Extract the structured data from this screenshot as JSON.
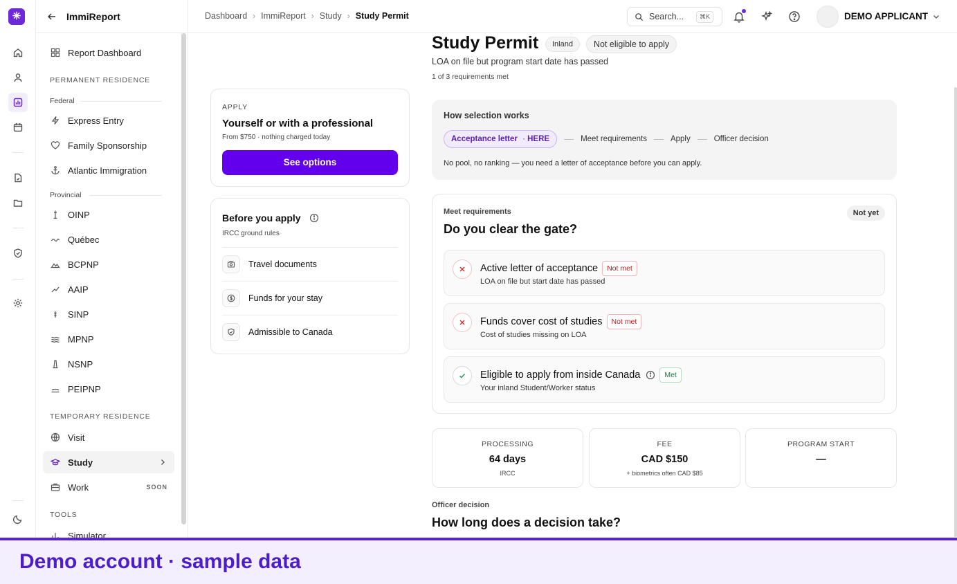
{
  "app": {
    "name": "ImmiReport"
  },
  "breadcrumbs": [
    "Dashboard",
    "ImmiReport",
    "Study",
    "Study Permit"
  ],
  "topbar": {
    "search_placeholder": "Search...",
    "search_shortcut": "⌘K",
    "user_name": "DEMO APPLICANT"
  },
  "sidebar": {
    "report_dashboard": "Report Dashboard",
    "section_pr": "PERMANENT RESIDENCE",
    "sub_federal": "Federal",
    "federal": [
      "Express Entry",
      "Family Sponsorship",
      "Atlantic Immigration"
    ],
    "sub_provincial": "Provincial",
    "provincial": [
      "OINP",
      "Québec",
      "BCPNP",
      "AAIP",
      "SINP",
      "MPNP",
      "NSNP",
      "PEIPNP"
    ],
    "section_tr": "TEMPORARY RESIDENCE",
    "temporary": [
      "Visit",
      "Study",
      "Work"
    ],
    "work_badge": "SOON",
    "section_tools": "TOOLS",
    "tools": [
      "Simulator"
    ]
  },
  "apply_card": {
    "eyebrow": "APPLY",
    "title": "Yourself or with a professional",
    "subtitle": "From $750 · nothing charged today",
    "button": "See options"
  },
  "before_card": {
    "title": "Before you apply",
    "subtitle": "IRCC ground rules",
    "items": [
      "Travel documents",
      "Funds for your stay",
      "Admissible to Canada"
    ]
  },
  "permit": {
    "title": "Study Permit",
    "badge_inland": "Inland",
    "badge_status": "Not eligible to apply",
    "subtitle": "LOA on file but program start date has passed",
    "meta": "1 of 3 requirements met"
  },
  "how": {
    "heading": "How selection works",
    "step_current": "Acceptance letter",
    "step_here_prefix": "·",
    "step_here": "HERE",
    "steps": [
      "Meet requirements",
      "Apply",
      "Officer decision"
    ],
    "note": "No pool, no ranking — you need a letter of acceptance before you can apply."
  },
  "gate": {
    "eyebrow": "Meet requirements",
    "title": "Do you clear the gate?",
    "status": "Not yet",
    "requirements": [
      {
        "title": "Active letter of acceptance",
        "tag": "Not met",
        "sub": "LOA on file but start date has passed"
      },
      {
        "title": "Funds cover cost of studies",
        "tag": "Not met",
        "sub": "Cost of studies missing on LOA"
      },
      {
        "title": "Eligible to apply from inside Canada",
        "tag": "Met",
        "sub": "Your inland Student/Worker status"
      }
    ]
  },
  "stats": [
    {
      "label": "PROCESSING",
      "value": "64 days",
      "note": "IRCC"
    },
    {
      "label": "FEE",
      "value": "CAD $150",
      "note": "+ biometrics often CAD $85"
    },
    {
      "label": "PROGRAM START",
      "value": "—",
      "note": ""
    }
  ],
  "officer": {
    "eyebrow": "Officer decision",
    "title": "How long does a decision take?"
  },
  "banner": {
    "text": "Demo account · sample data"
  },
  "colors": {
    "accent": "#6200ee",
    "not_met": "#b91c1c",
    "met": "#15803d",
    "banner_bg": "#f3efff"
  }
}
